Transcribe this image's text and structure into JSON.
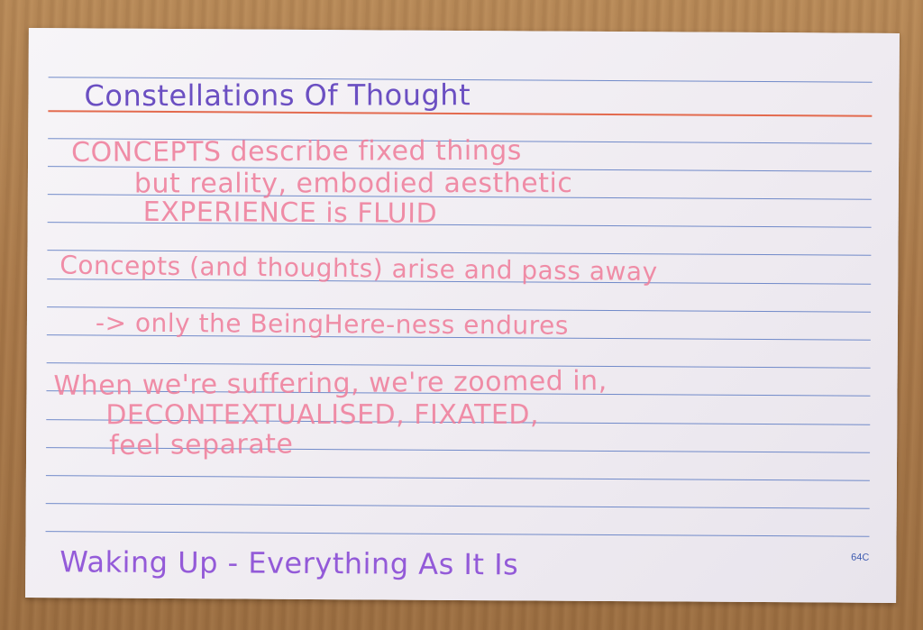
{
  "card": {
    "title": "Constellations Of Thought",
    "lines": [
      "CONCEPTS describe fixed things",
      "but reality, embodied aesthetic",
      "EXPERIENCE is FLUID",
      "Concepts (and thoughts) arise and pass away",
      "-> only the BeingHere-ness endures",
      "When we're suffering, we're zoomed in,",
      "DECONTEXTUALISED, FIXATED,",
      "feel separate"
    ],
    "footer": "Waking Up - Everything As It Is",
    "card_id": "64C"
  },
  "colors": {
    "title_ink": "#6b4fc2",
    "body_ink": "#ef7f9c",
    "footer_ink": "#8a4bd6",
    "rule_blue": "#5b79c2",
    "rule_red": "#e36a4e"
  }
}
